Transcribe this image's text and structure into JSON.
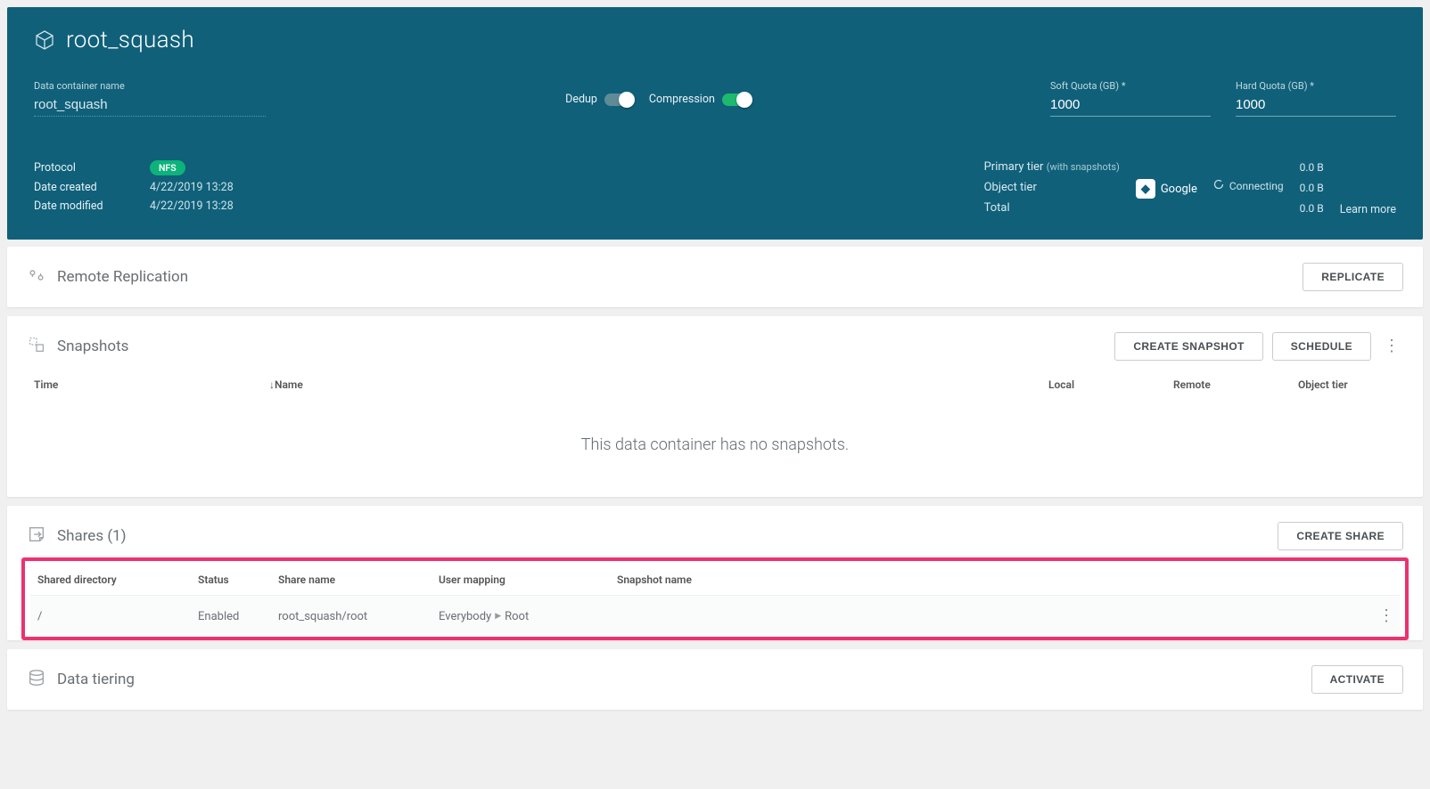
{
  "header": {
    "title": "root_squash",
    "container_name_label": "Data container name",
    "container_name_value": "root_squash",
    "dedup_label": "Dedup",
    "compression_label": "Compression",
    "soft_quota_label": "Soft Quota (GB) *",
    "soft_quota_value": "1000",
    "hard_quota_label": "Hard Quota (GB) *",
    "hard_quota_value": "1000",
    "meta": {
      "protocol_label": "Protocol",
      "protocol_badge": "NFS",
      "date_created_label": "Date created",
      "date_created_value": "4/22/2019 13:28",
      "date_modified_label": "Date modified",
      "date_modified_value": "4/22/2019 13:28"
    },
    "tiers": {
      "primary_label": "Primary tier",
      "primary_sub": "(with snapshots)",
      "object_label": "Object tier",
      "total_label": "Total",
      "cloud_provider": "Google",
      "connecting_text": "Connecting",
      "primary_val": "0.0 B",
      "object_val": "0.0 B",
      "total_val": "0.0 B",
      "learn_more": "Learn more"
    }
  },
  "replication": {
    "title": "Remote Replication",
    "button": "REPLICATE"
  },
  "snapshots": {
    "title": "Snapshots",
    "create_button": "CREATE SNAPSHOT",
    "schedule_button": "SCHEDULE",
    "columns": {
      "time": "Time",
      "name": "Name",
      "local": "Local",
      "remote": "Remote",
      "object": "Object tier"
    },
    "empty_message": "This data container has no snapshots."
  },
  "shares": {
    "title": "Shares (1)",
    "create_button": "CREATE SHARE",
    "columns": {
      "dir": "Shared directory",
      "status": "Status",
      "name": "Share name",
      "mapping": "User mapping",
      "snapshot": "Snapshot name"
    },
    "rows": [
      {
        "dir": "/",
        "status": "Enabled",
        "name": "root_squash/root",
        "mapping_from": "Everybody",
        "mapping_to": "Root",
        "snapshot": ""
      }
    ]
  },
  "tiering": {
    "title": "Data tiering",
    "button": "ACTIVATE"
  }
}
